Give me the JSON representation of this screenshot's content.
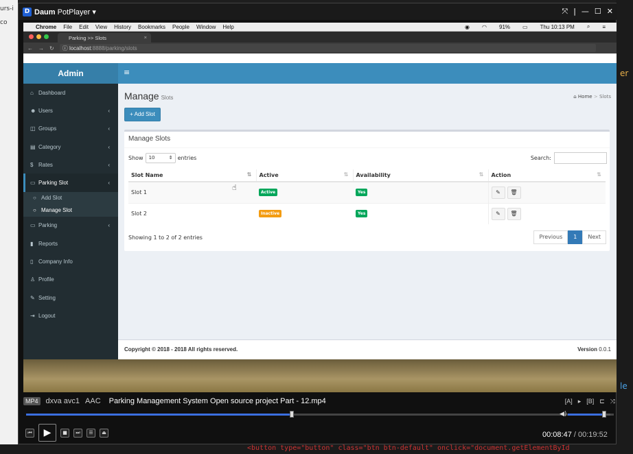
{
  "background": {
    "left_text_1": "urs-i",
    "left_text_2": "co",
    "right_text_1": "er",
    "right_text_2": "le",
    "bottom_code": "<button type=\"button\" class=\"btn btn-default\" onclick=\"document.getElementById"
  },
  "player": {
    "app_name": "Daum",
    "app_name_suffix": "PotPlayer",
    "logo_letter": "D",
    "winbtns": [
      "⤧",
      "|",
      "—",
      "☐",
      "✕"
    ],
    "info": {
      "container": "MP4",
      "codec": "dxva avc1",
      "audio": "AAC",
      "filename": "Parking Management System Open source project Part - 12.mp4"
    },
    "progress": 0.4524,
    "volume": 0.85,
    "time_current": "00:08:47",
    "time_sep": "/",
    "time_total": "00:19:52"
  },
  "macbar": {
    "apple": "",
    "app": "Chrome",
    "menus": [
      "File",
      "Edit",
      "View",
      "History",
      "Bookmarks",
      "People",
      "Window",
      "Help"
    ],
    "battery": "91%",
    "clock": "Thu 10:13 PM"
  },
  "browser": {
    "tab_title": "Parking >> Slots",
    "url_host": "localhost",
    "url_rest": ":8888/parking/slots"
  },
  "sidebar": {
    "brand": "Admin",
    "items": [
      {
        "label": "Dashboard",
        "icon": "⌂"
      },
      {
        "label": "Users",
        "icon": "👥"
      },
      {
        "label": "Groups",
        "icon": "◫"
      },
      {
        "label": "Category",
        "icon": "▤"
      },
      {
        "label": "Rates",
        "icon": "$"
      },
      {
        "label": "Parking Slot",
        "icon": "▭"
      },
      {
        "label": "Add Slot",
        "icon": "○"
      },
      {
        "label": "Manage Slot",
        "icon": "○"
      },
      {
        "label": "Parking",
        "icon": "▭"
      },
      {
        "label": "Reports",
        "icon": "▮"
      },
      {
        "label": "Company Info",
        "icon": "▯"
      },
      {
        "label": "Profile",
        "icon": "♙"
      },
      {
        "label": "Setting",
        "icon": "✎"
      },
      {
        "label": "Logout",
        "icon": "⇥"
      }
    ]
  },
  "page": {
    "title": "Manage",
    "subtitle": "Slots",
    "crumb_home": "Home",
    "crumb_sep": ">",
    "crumb_current": "Slots",
    "add_button": "+ Add Slot",
    "box_title": "Manage Slots",
    "show_label": "Show",
    "entries_value": "10",
    "entries_label": "entries",
    "search_label": "Search:",
    "columns": [
      "Slot Name",
      "Active",
      "Availability",
      "Action"
    ],
    "rows": [
      {
        "name": "Slot 1",
        "active": "Active",
        "active_color": "#00a65a",
        "availability": "Yes"
      },
      {
        "name": "Slot 2",
        "active": "Inactive",
        "active_color": "#f39c12",
        "availability": "Yes"
      }
    ],
    "info": "Showing 1 to 2 of 2 entries",
    "pager": {
      "prev": "Previous",
      "current": "1",
      "next": "Next"
    },
    "footer": "Copyright © 2018 - 2018 All rights reserved.",
    "version_label": "Version",
    "version_value": "0.0.1"
  }
}
